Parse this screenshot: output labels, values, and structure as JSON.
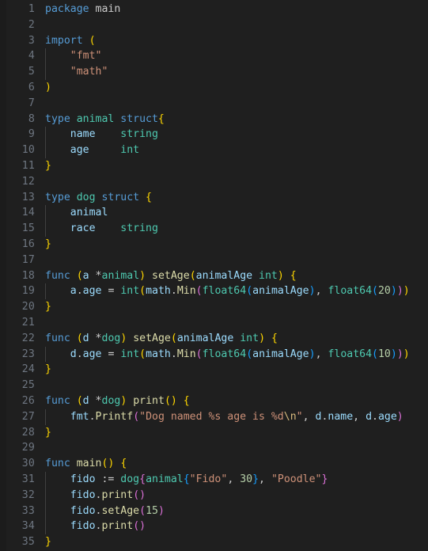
{
  "editor": {
    "language": "go",
    "theme": "dark-modern",
    "background_color": "#1f1f1f",
    "gutter_color": "#6e7681",
    "default_text_color": "#cccccc",
    "indent_guide_color": "#404040",
    "total_lines": 35,
    "colors": {
      "keyword": "#569cd6",
      "type": "#4ec9b0",
      "variable": "#9cdcfe",
      "function": "#dcdcaa",
      "string": "#ce9178",
      "escape": "#d7ba7d",
      "number": "#b5cea8",
      "operator": "#cccccc",
      "bracket_level_1": "#ffd700",
      "bracket_level_2": "#da70d6",
      "bracket_level_3": "#179fff",
      "bracket_level_4": "#b267e6"
    }
  },
  "line_numbers": [
    "1",
    "2",
    "3",
    "4",
    "5",
    "6",
    "7",
    "8",
    "9",
    "10",
    "11",
    "12",
    "13",
    "14",
    "15",
    "16",
    "17",
    "18",
    "19",
    "20",
    "21",
    "22",
    "23",
    "24",
    "25",
    "26",
    "27",
    "28",
    "29",
    "30",
    "31",
    "32",
    "33",
    "34",
    "35"
  ],
  "source_lines": [
    "package main",
    "",
    "import (",
    "    \"fmt\"",
    "    \"math\"",
    ")",
    "",
    "type animal struct{",
    "    name    string",
    "    age     int",
    "}",
    "",
    "type dog struct {",
    "    animal",
    "    race    string",
    "}",
    "",
    "func (a *animal) setAge(animalAge int) {",
    "    a.age = int(math.Min(float64(animalAge), float64(20)))",
    "}",
    "",
    "func (d *dog) setAge(animalAge int) {",
    "    d.age = int(math.Min(float64(animalAge), float64(10)))",
    "}",
    "",
    "func (d *dog) print() {",
    "    fmt.Printf(\"Dog named %s age is %d\\n\", d.name, d.age)",
    "}",
    "",
    "func main() {",
    "    fido := dog{animal{\"Fido\", 30}, \"Poodle\"}",
    "    fido.print()",
    "    fido.setAge(15)",
    "    fido.print()",
    "}"
  ],
  "tokens": {
    "l1": [
      [
        "package ",
        "kw"
      ],
      [
        "main",
        "op"
      ]
    ],
    "l3": [
      [
        "import ",
        "kw"
      ],
      [
        "(",
        "b1"
      ]
    ],
    "l4": [
      [
        "    ",
        ""
      ],
      [
        "\"fmt\"",
        "str"
      ]
    ],
    "l5": [
      [
        "    ",
        ""
      ],
      [
        "\"math\"",
        "str"
      ]
    ],
    "l6": [
      [
        ")",
        "b1"
      ]
    ],
    "l8": [
      [
        "type ",
        "kw"
      ],
      [
        "animal ",
        "typ"
      ],
      [
        "struct",
        "kw"
      ],
      [
        "{",
        "b1"
      ]
    ],
    "l9": [
      [
        "    ",
        ""
      ],
      [
        "name",
        "var"
      ],
      [
        "    ",
        ""
      ],
      [
        "string",
        "typ"
      ]
    ],
    "l10": [
      [
        "    ",
        ""
      ],
      [
        "age",
        "var"
      ],
      [
        "     ",
        ""
      ],
      [
        "int",
        "typ"
      ]
    ],
    "l11": [
      [
        "}",
        "b1"
      ]
    ],
    "l13": [
      [
        "type ",
        "kw"
      ],
      [
        "dog ",
        "typ"
      ],
      [
        "struct ",
        "kw"
      ],
      [
        "{",
        "b1"
      ]
    ],
    "l14": [
      [
        "    ",
        ""
      ],
      [
        "animal",
        "var"
      ]
    ],
    "l15": [
      [
        "    ",
        ""
      ],
      [
        "race",
        "var"
      ],
      [
        "    ",
        ""
      ],
      [
        "string",
        "typ"
      ]
    ],
    "l16": [
      [
        "}",
        "b1"
      ]
    ],
    "l18": [
      [
        "func ",
        "kw"
      ],
      [
        "(",
        "b1"
      ],
      [
        "a ",
        "var"
      ],
      [
        "*",
        "op"
      ],
      [
        "animal",
        "typ"
      ],
      [
        ")",
        "b1"
      ],
      [
        " ",
        ""
      ],
      [
        "setAge",
        "fn"
      ],
      [
        "(",
        "b1"
      ],
      [
        "animalAge ",
        "var"
      ],
      [
        "int",
        "typ"
      ],
      [
        ")",
        "b1"
      ],
      [
        " ",
        ""
      ],
      [
        "{",
        "b1"
      ]
    ],
    "l19": [
      [
        "    ",
        ""
      ],
      [
        "a",
        "var"
      ],
      [
        ".",
        "op"
      ],
      [
        "age",
        "var"
      ],
      [
        " = ",
        "op"
      ],
      [
        "int",
        "typ"
      ],
      [
        "(",
        "b1"
      ],
      [
        "math",
        "var"
      ],
      [
        ".",
        "op"
      ],
      [
        "Min",
        "fn"
      ],
      [
        "(",
        "b2"
      ],
      [
        "float64",
        "typ"
      ],
      [
        "(",
        "b3"
      ],
      [
        "animalAge",
        "var"
      ],
      [
        ")",
        "b3"
      ],
      [
        ", ",
        "op"
      ],
      [
        "float64",
        "typ"
      ],
      [
        "(",
        "b3"
      ],
      [
        "20",
        "num"
      ],
      [
        ")",
        "b3"
      ],
      [
        ")",
        "b2"
      ],
      [
        ")",
        "b1"
      ]
    ],
    "l20": [
      [
        "}",
        "b1"
      ]
    ],
    "l22": [
      [
        "func ",
        "kw"
      ],
      [
        "(",
        "b1"
      ],
      [
        "d ",
        "var"
      ],
      [
        "*",
        "op"
      ],
      [
        "dog",
        "typ"
      ],
      [
        ")",
        "b1"
      ],
      [
        " ",
        ""
      ],
      [
        "setAge",
        "fn"
      ],
      [
        "(",
        "b1"
      ],
      [
        "animalAge ",
        "var"
      ],
      [
        "int",
        "typ"
      ],
      [
        ")",
        "b1"
      ],
      [
        " ",
        ""
      ],
      [
        "{",
        "b1"
      ]
    ],
    "l23": [
      [
        "    ",
        ""
      ],
      [
        "d",
        "var"
      ],
      [
        ".",
        "op"
      ],
      [
        "age",
        "var"
      ],
      [
        " = ",
        "op"
      ],
      [
        "int",
        "typ"
      ],
      [
        "(",
        "b1"
      ],
      [
        "math",
        "var"
      ],
      [
        ".",
        "op"
      ],
      [
        "Min",
        "fn"
      ],
      [
        "(",
        "b2"
      ],
      [
        "float64",
        "typ"
      ],
      [
        "(",
        "b3"
      ],
      [
        "animalAge",
        "var"
      ],
      [
        ")",
        "b3"
      ],
      [
        ", ",
        "op"
      ],
      [
        "float64",
        "typ"
      ],
      [
        "(",
        "b3"
      ],
      [
        "10",
        "num"
      ],
      [
        ")",
        "b3"
      ],
      [
        ")",
        "b2"
      ],
      [
        ")",
        "b1"
      ]
    ],
    "l24": [
      [
        "}",
        "b1"
      ]
    ],
    "l26": [
      [
        "func ",
        "kw"
      ],
      [
        "(",
        "b1"
      ],
      [
        "d ",
        "var"
      ],
      [
        "*",
        "op"
      ],
      [
        "dog",
        "typ"
      ],
      [
        ")",
        "b1"
      ],
      [
        " ",
        ""
      ],
      [
        "print",
        "fn"
      ],
      [
        "(",
        "b1"
      ],
      [
        ")",
        "b1"
      ],
      [
        " ",
        ""
      ],
      [
        "{",
        "b1"
      ]
    ],
    "l27": [
      [
        "    ",
        ""
      ],
      [
        "fmt",
        "var"
      ],
      [
        ".",
        "op"
      ],
      [
        "Printf",
        "fn"
      ],
      [
        "(",
        "b2"
      ],
      [
        "\"Dog named %s age is %d",
        "str"
      ],
      [
        "\\n",
        "esc"
      ],
      [
        "\"",
        "str"
      ],
      [
        ", ",
        "op"
      ],
      [
        "d",
        "var"
      ],
      [
        ".",
        "op"
      ],
      [
        "name",
        "var"
      ],
      [
        ", ",
        "op"
      ],
      [
        "d",
        "var"
      ],
      [
        ".",
        "op"
      ],
      [
        "age",
        "var"
      ],
      [
        ")",
        "b2"
      ]
    ],
    "l28": [
      [
        "}",
        "b1"
      ]
    ],
    "l30": [
      [
        "func ",
        "kw"
      ],
      [
        "main",
        "fn"
      ],
      [
        "(",
        "b1"
      ],
      [
        ")",
        "b1"
      ],
      [
        " ",
        ""
      ],
      [
        "{",
        "b1"
      ]
    ],
    "l31": [
      [
        "    ",
        ""
      ],
      [
        "fido",
        "var"
      ],
      [
        " := ",
        "op"
      ],
      [
        "dog",
        "typ"
      ],
      [
        "{",
        "b2"
      ],
      [
        "animal",
        "typ"
      ],
      [
        "{",
        "b3"
      ],
      [
        "\"Fido\"",
        "str"
      ],
      [
        ", ",
        "op"
      ],
      [
        "30",
        "num"
      ],
      [
        "}",
        "b3"
      ],
      [
        ", ",
        "op"
      ],
      [
        "\"Poodle\"",
        "str"
      ],
      [
        "}",
        "b2"
      ]
    ],
    "l32": [
      [
        "    ",
        ""
      ],
      [
        "fido",
        "var"
      ],
      [
        ".",
        "op"
      ],
      [
        "print",
        "fn"
      ],
      [
        "(",
        "b2"
      ],
      [
        ")",
        "b2"
      ]
    ],
    "l33": [
      [
        "    ",
        ""
      ],
      [
        "fido",
        "var"
      ],
      [
        ".",
        "op"
      ],
      [
        "setAge",
        "fn"
      ],
      [
        "(",
        "b2"
      ],
      [
        "15",
        "num"
      ],
      [
        ")",
        "b2"
      ]
    ],
    "l34": [
      [
        "    ",
        ""
      ],
      [
        "fido",
        "var"
      ],
      [
        ".",
        "op"
      ],
      [
        "print",
        "fn"
      ],
      [
        "(",
        "b2"
      ],
      [
        ")",
        "b2"
      ]
    ],
    "l35": [
      [
        "}",
        "b1"
      ]
    ]
  },
  "indent_guides": {
    "level1_lines": [
      4,
      5,
      9,
      10,
      14,
      15,
      19,
      23,
      27,
      31,
      32,
      33,
      34
    ],
    "level2_lines": []
  }
}
